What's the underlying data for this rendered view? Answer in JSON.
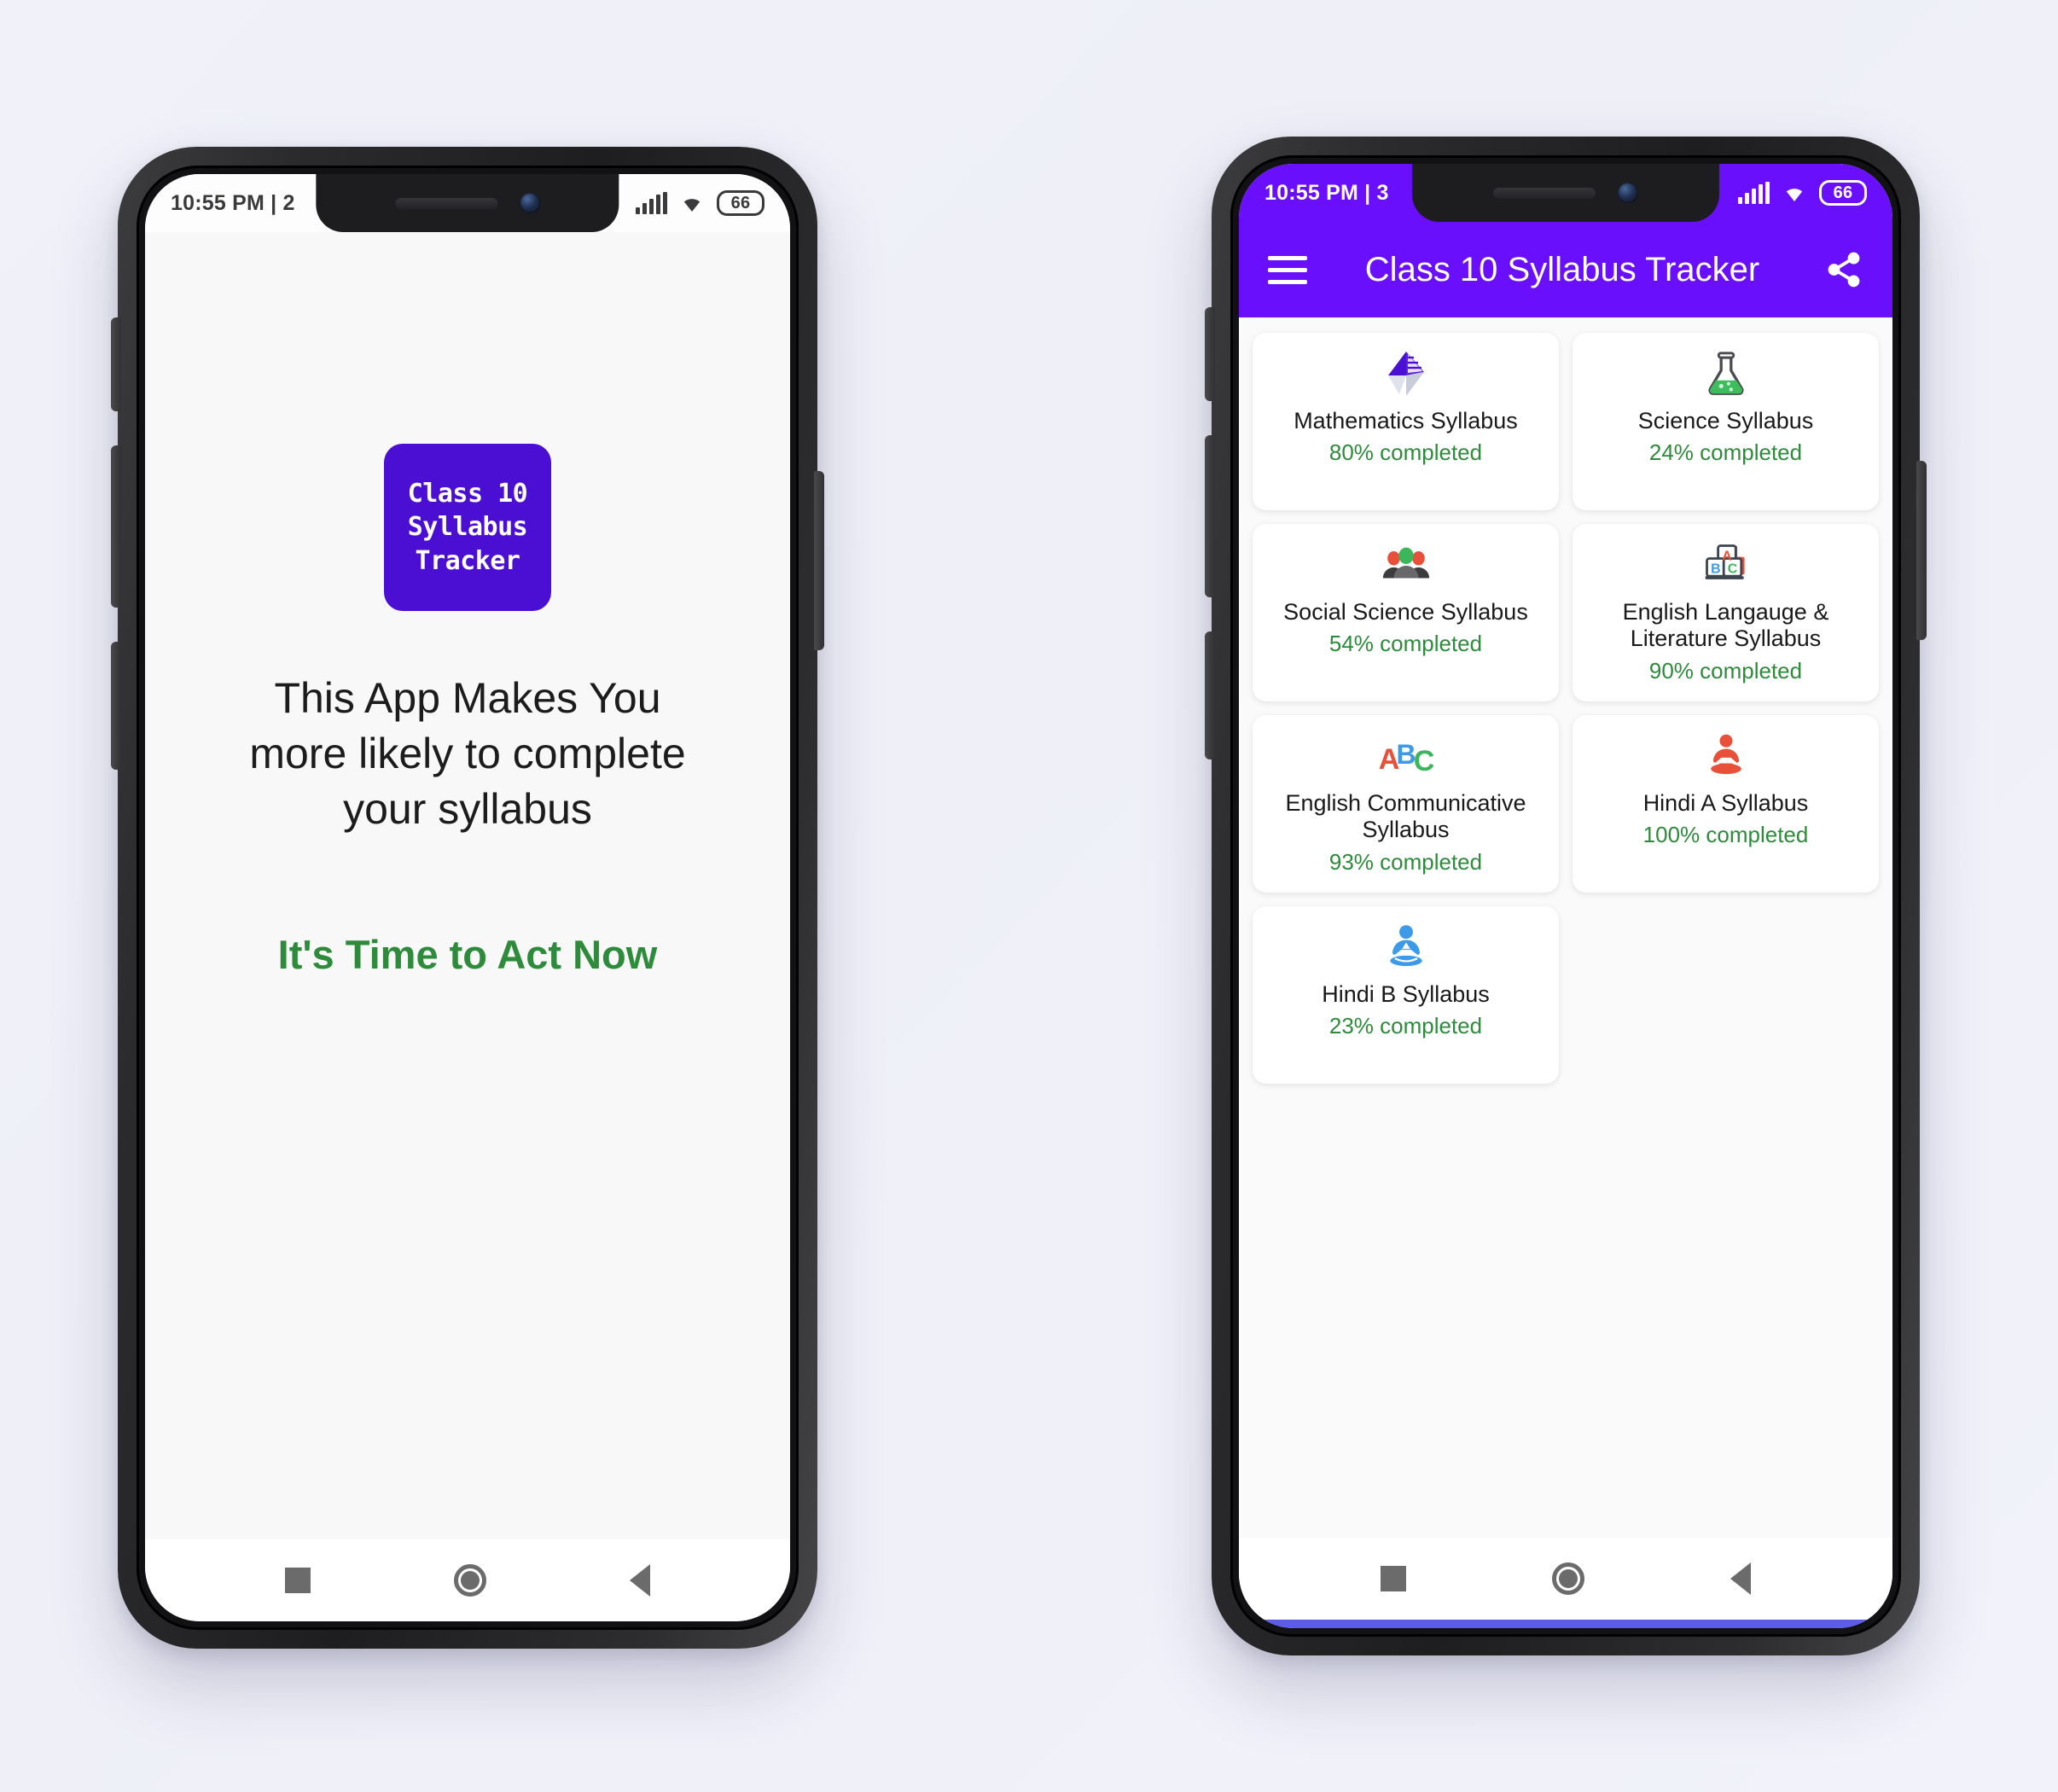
{
  "page": {
    "background_color": "#eff0f8"
  },
  "colors": {
    "brand_purple": "#6a0ffb",
    "logo_purple": "#4b0fd4",
    "success_green": "#2e8b3b",
    "card_bg": "#ffffff",
    "screen_bg": "#fafafa"
  },
  "phone1": {
    "status_bar": {
      "time": "10:55 PM | 2",
      "battery": "66",
      "signal_icon": "signal-bars-icon",
      "wifi_icon": "wifi-icon",
      "battery_icon": "battery-icon"
    },
    "splash": {
      "logo_line1": "Class 10",
      "logo_line2": "Syllabus",
      "logo_line3": "Tracker",
      "tagline": "This App Makes You more likely to complete your syllabus",
      "cta": "It's Time to Act Now"
    },
    "navbar": {
      "recents_label": "recents-square",
      "home_label": "home-circle",
      "back_label": "back-triangle"
    }
  },
  "phone2": {
    "status_bar": {
      "time": "10:55 PM | 3",
      "battery": "66",
      "signal_icon": "signal-bars-icon",
      "wifi_icon": "wifi-icon",
      "battery_icon": "battery-icon"
    },
    "appbar": {
      "menu_icon": "hamburger-menu-icon",
      "title": "Class 10 Syllabus Tracker",
      "share_icon": "share-icon"
    },
    "cards": [
      {
        "title": "Mathematics Syllabus",
        "progress_text": "80% completed",
        "percent": 80,
        "icon": "pyramid-prism-icon"
      },
      {
        "title": "Science Syllabus",
        "progress_text": "24% completed",
        "percent": 24,
        "icon": "flask-icon"
      },
      {
        "title": "Social Science Syllabus",
        "progress_text": "54% completed",
        "percent": 54,
        "icon": "people-group-icon"
      },
      {
        "title": "English Langauge & Literature Syllabus",
        "progress_text": "90% completed",
        "percent": 90,
        "icon": "abc-blocks-icon"
      },
      {
        "title": "English Communicative Syllabus",
        "progress_text": "93% completed",
        "percent": 93,
        "icon": "abc-letters-icon"
      },
      {
        "title": "Hindi A Syllabus",
        "progress_text": "100% completed",
        "percent": 100,
        "icon": "meditation-red-icon"
      },
      {
        "title": "Hindi B Syllabus",
        "progress_text": "23% completed",
        "percent": 23,
        "icon": "meditation-blue-icon"
      }
    ],
    "navbar": {
      "recents_label": "recents-square",
      "home_label": "home-circle",
      "back_label": "back-triangle"
    }
  }
}
